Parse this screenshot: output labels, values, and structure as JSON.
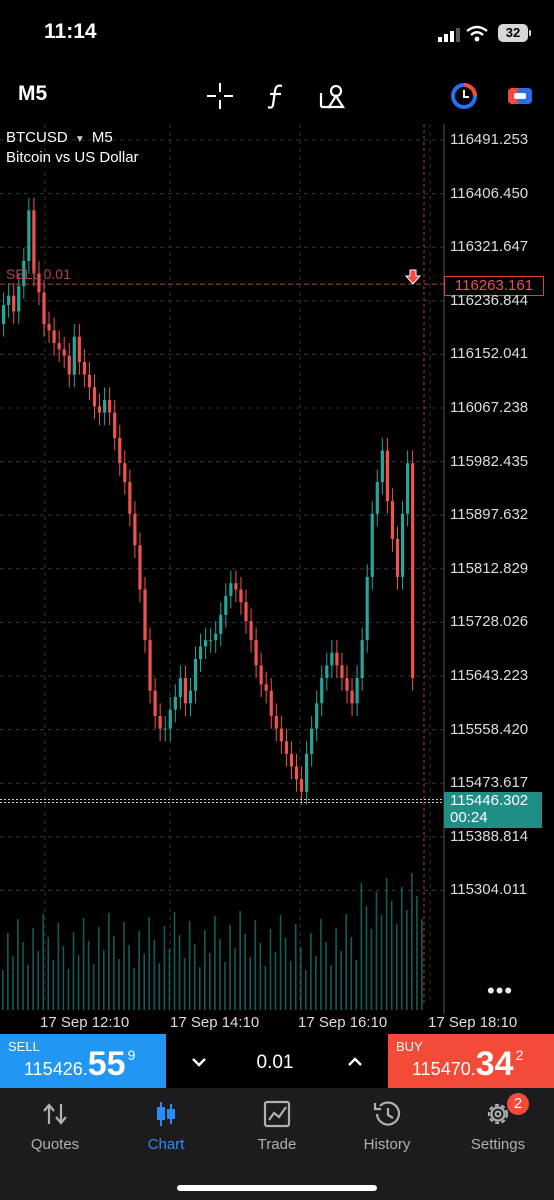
{
  "status": {
    "time": "11:14",
    "battery": "32"
  },
  "toolbar": {
    "timeframe": "M5"
  },
  "chart": {
    "symbol": "BTCUSD",
    "symbol_timeframe": "M5",
    "description": "Bitcoin vs US Dollar",
    "price_labels": [
      "116491.253",
      "116406.450",
      "116321.647",
      "116236.844",
      "116152.041",
      "116067.238",
      "115982.435",
      "115897.632",
      "115812.829",
      "115728.026",
      "115643.223",
      "115558.420",
      "115473.617",
      "115388.814",
      "115304.011"
    ],
    "date_labels": [
      "17 Sep 12:10",
      "17 Sep 14:10",
      "17 Sep 16:10",
      "17 Sep 18:10"
    ],
    "sell_level": {
      "text": "SELL 0.01",
      "price": "116263.161"
    },
    "bid": {
      "price": "115446.302",
      "countdown": "00:24"
    },
    "colors": {
      "bull": "#26a69a",
      "bear": "#ef5350",
      "grid": "#2a3442"
    }
  },
  "trade": {
    "sell": {
      "caption": "SELL",
      "price_main": "115426.",
      "price_big": "55",
      "price_sup": "9",
      "color": "#2196f3"
    },
    "buy": {
      "caption": "BUY",
      "price_main": "115470.",
      "price_big": "34",
      "price_sup": "2",
      "color": "#f44b38"
    },
    "lot": "0.01"
  },
  "nav": {
    "items": [
      {
        "label": "Quotes",
        "icon": "quotes-arrows-icon"
      },
      {
        "label": "Chart",
        "icon": "candlestick-chart-icon",
        "active": true
      },
      {
        "label": "Trade",
        "icon": "trade-line-chart-icon"
      },
      {
        "label": "History",
        "icon": "history-clock-icon"
      },
      {
        "label": "Settings",
        "icon": "gear-icon"
      }
    ],
    "settings_badge": "2"
  }
}
